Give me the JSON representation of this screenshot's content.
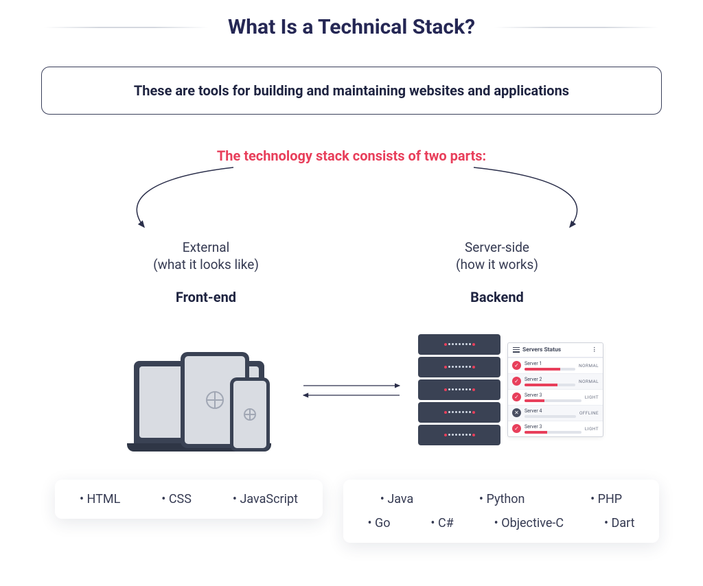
{
  "title": "What Is a Technical Stack?",
  "description": "These are tools for building and maintaining websites and applications",
  "subtitle": "The technology stack consists of two parts:",
  "branches": {
    "left": {
      "line1": "External",
      "line2": "(what it looks like)",
      "heading": "Front-end"
    },
    "right": {
      "line1": "Server-side",
      "line2": "(how it works)",
      "heading": "Backend"
    }
  },
  "servers_panel": {
    "title": "Servers Status",
    "rows": [
      {
        "name": "Server 1",
        "status": "NORMAL",
        "fill": 70,
        "online": true
      },
      {
        "name": "Server 2",
        "status": "NORMAL",
        "fill": 65,
        "online": true
      },
      {
        "name": "Server 3",
        "status": "LIGHT",
        "fill": 35,
        "online": true
      },
      {
        "name": "Server 4",
        "status": "OFFLINE",
        "fill": 0,
        "online": false
      },
      {
        "name": "Server 3",
        "status": "LIGHT",
        "fill": 40,
        "online": true
      }
    ]
  },
  "frontend_techs": [
    "HTML",
    "CSS",
    "JavaScript"
  ],
  "backend_techs_row1": [
    "Java",
    "Python",
    "PHP"
  ],
  "backend_techs_row2": [
    "Go",
    "C#",
    "Objective-C",
    "Dart"
  ]
}
